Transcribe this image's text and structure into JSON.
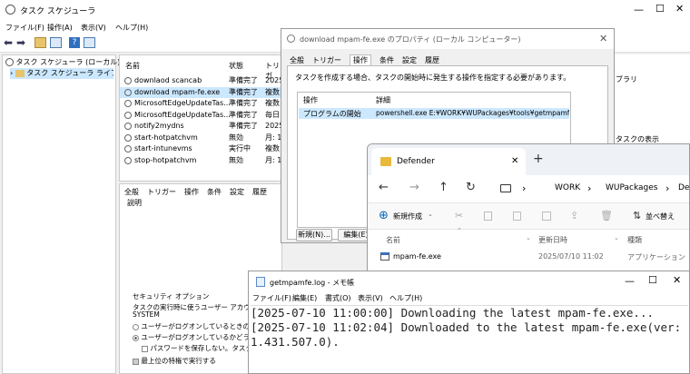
{
  "main": {
    "title": "タスク スケジューラ",
    "menu": [
      "ファイル(F)",
      "操作(A)",
      "表示(V)",
      "ヘルプ(H)"
    ],
    "tree": [
      "タスク スケジューラ (ローカル)",
      "タスク スケジューラ ライブラリ"
    ],
    "columns": [
      "名前",
      "状態",
      "トリガ"
    ],
    "rows": [
      {
        "name": "downlaod scancab",
        "status": "準備完了",
        "trigger": "2025"
      },
      {
        "name": "download mpam-fe.exe",
        "status": "準備完了",
        "trigger": "複数"
      },
      {
        "name": "MicrosoftEdgeUpdateTas...",
        "status": "準備完了",
        "trigger": "複数"
      },
      {
        "name": "MicrosoftEdgeUpdateTas...",
        "status": "準備完了",
        "trigger": "毎日"
      },
      {
        "name": "notify2mydns",
        "status": "準備完了",
        "trigger": "2025"
      },
      {
        "name": "start-hotpatchvm",
        "status": "無効",
        "trigger": "月: 1"
      },
      {
        "name": "start-intunevms",
        "status": "実行中",
        "trigger": "複数"
      },
      {
        "name": "stop-hotpatchvm",
        "status": "無効",
        "trigger": "月: 1"
      }
    ],
    "detail_tabs": [
      "全般",
      "トリガー",
      "操作",
      "条件",
      "設定",
      "履歴"
    ],
    "detail_desc_label": "説明",
    "security": {
      "group": "セキュリティ オプション",
      "line1": "タスクの実行時に使うユーザー アカウント",
      "account": "SYSTEM",
      "radio1": "ユーザーがログオンしているときのみ実",
      "radio2": "ユーザーがログオンしているかどうかに",
      "nosave": "パスワードを保存しない。タスク",
      "highest": "最上位の特権で実行する"
    },
    "right_labels": [
      "ブラリ",
      "タスクの表示"
    ]
  },
  "props": {
    "title": "download mpam-fe.exe のプロパティ (ローカル コンピューター)",
    "tabs": [
      "全般",
      "トリガー",
      "操作",
      "条件",
      "設定",
      "履歴"
    ],
    "active_tab": "操作",
    "desc": "タスクを作成する場合、タスクの開始時に発生する操作を指定する必要があります。",
    "col_action": "操作",
    "col_detail": "詳細",
    "row_action": "プログラムの開始",
    "row_detail": "powershell.exe E:¥WORK¥WUPackages¥tools¥getmpamfe.ps1",
    "btn_new": "新規(N)...",
    "btn_edit": "編集(E)"
  },
  "explorer": {
    "tab_title": "Defender",
    "path": [
      "WORK",
      "WUPackages",
      "De"
    ],
    "new_btn": "新規作成",
    "sort_btn": "並べ替え",
    "col_name": "名前",
    "col_date": "更新日時",
    "col_type": "種類",
    "file_name": "mpam-fe.exe",
    "file_date": "2025/07/10 11:02",
    "file_type": "アプリケーション"
  },
  "notepad": {
    "title": "getmpamfe.log - メモ帳",
    "menu": [
      "ファイル(F)",
      "編集(E)",
      "書式(O)",
      "表示(V)",
      "ヘルプ(H)"
    ],
    "lines": [
      "[2025-07-10 11:00:00] Downloading the latest mpam-fe.exe...",
      "[2025-07-10 11:02:04] Downloaded to the latest mpam-fe.exe(ver:",
      "1.431.507.0)."
    ]
  },
  "colors": {
    "accent": "#0067c0",
    "selection": "#cce8ff",
    "folder": "#e8b93a"
  }
}
